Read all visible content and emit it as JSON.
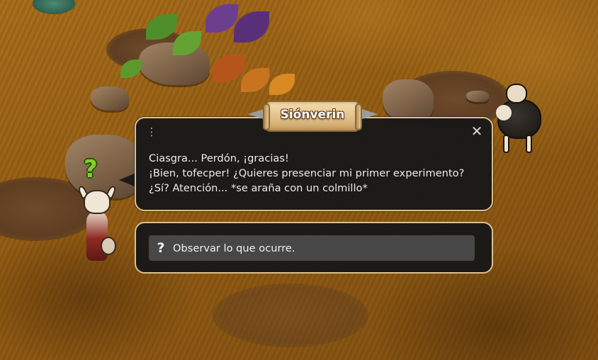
{
  "npc_name": "Siónverin",
  "dialog": {
    "menu_icon": "⋮",
    "close_icon": "✕",
    "lines": [
      "Ciasgra... Perdón, ¡gracias!",
      "¡Bien, tofecper! ¿Quieres presenciar mi primer experimento?",
      "¿Sí? Atención... *se araña con un colmillo*"
    ]
  },
  "answers": [
    {
      "icon": "?",
      "label": "Observar lo que ocurre."
    }
  ],
  "quest_marker": "?",
  "colors": {
    "dialog_bg": "#181818",
    "dialog_border": "#d9c08e",
    "answer_bg": "#474747",
    "quest_marker": "#7fcf2a"
  }
}
